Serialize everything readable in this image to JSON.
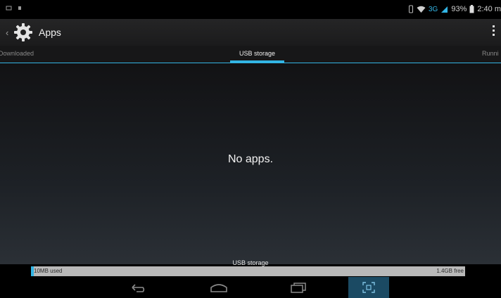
{
  "status": {
    "network": "3G",
    "battery": "93%",
    "time": "2:40 m"
  },
  "action_bar": {
    "title": "Apps"
  },
  "tabs": [
    {
      "label": "Downloaded"
    },
    {
      "label": "USB storage"
    },
    {
      "label": "Runni"
    }
  ],
  "content": {
    "empty_message": "No apps."
  },
  "storage": {
    "label": "USB storage",
    "used": "10MB used",
    "free": "1.4GB free",
    "used_fraction": 0.007
  },
  "colors": {
    "accent": "#33b5e5"
  },
  "icons": {
    "status_left": [
      "notification-icon",
      "notification-icon"
    ],
    "status_right": [
      "vibrate-icon",
      "wifi-icon",
      "signal-icon",
      "battery-icon"
    ],
    "nav": [
      "back-icon",
      "home-icon",
      "recents-icon",
      "screenshot-icon"
    ]
  }
}
